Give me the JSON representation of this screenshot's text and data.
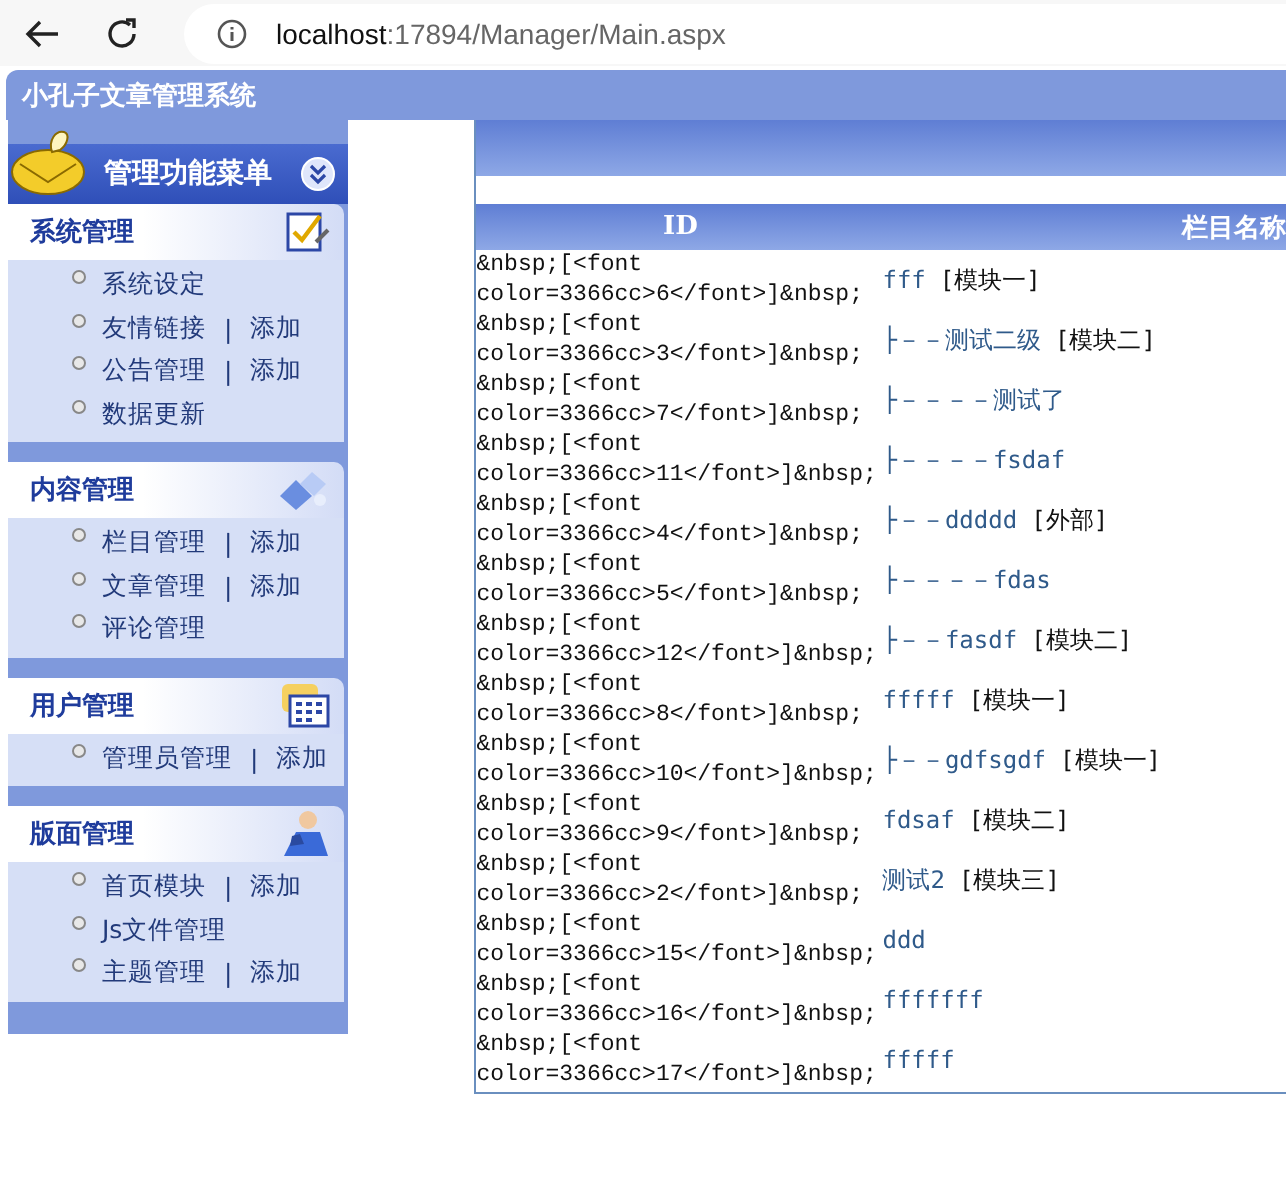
{
  "browser": {
    "url_host": "localhost",
    "url_path": ":17894/Manager/Main.aspx"
  },
  "title": "小孔子文章管理系统",
  "sidebar": {
    "heading": "管理功能菜单",
    "separator": "|",
    "sections": [
      {
        "title": "系统管理",
        "items": [
          {
            "links": [
              "系统设定"
            ]
          },
          {
            "links": [
              "友情链接",
              "添加"
            ]
          },
          {
            "links": [
              "公告管理",
              "添加"
            ]
          },
          {
            "links": [
              "数据更新"
            ]
          }
        ]
      },
      {
        "title": "内容管理",
        "items": [
          {
            "links": [
              "栏目管理",
              "添加"
            ]
          },
          {
            "links": [
              "文章管理",
              "添加"
            ]
          },
          {
            "links": [
              "评论管理"
            ]
          }
        ]
      },
      {
        "title": "用户管理",
        "items": [
          {
            "links": [
              "管理员管理",
              "添加"
            ]
          }
        ]
      },
      {
        "title": "版面管理",
        "items": [
          {
            "links": [
              "首页模块",
              "添加"
            ]
          },
          {
            "links": [
              "Js文件管理"
            ]
          },
          {
            "links": [
              "主题管理",
              "添加"
            ]
          }
        ]
      }
    ]
  },
  "table": {
    "columns": [
      "ID",
      "栏目名称"
    ],
    "rows": [
      {
        "id": "&nbsp;[<font color=3366cc>6</font>]&nbsp;",
        "name": "fff",
        "module": "[模块一]"
      },
      {
        "id": "&nbsp;[<font color=3366cc>3</font>]&nbsp;",
        "name": "├－－测试二级",
        "module": "[模块二]"
      },
      {
        "id": "&nbsp;[<font color=3366cc>7</font>]&nbsp;",
        "name": "├－－－－测试了"
      },
      {
        "id": "&nbsp;[<font color=3366cc>11</font>]&nbsp;",
        "name": "├－－－－fsdaf"
      },
      {
        "id": "&nbsp;[<font color=3366cc>4</font>]&nbsp;",
        "name": "├－－ddddd",
        "module": "[外部]"
      },
      {
        "id": "&nbsp;[<font color=3366cc>5</font>]&nbsp;",
        "name": "├－－－－fdas"
      },
      {
        "id": "&nbsp;[<font color=3366cc>12</font>]&nbsp;",
        "name": "├－－fasdf",
        "module": "[模块二]"
      },
      {
        "id": "&nbsp;[<font color=3366cc>8</font>]&nbsp;",
        "name": "fffff",
        "module": "[模块一]"
      },
      {
        "id": "&nbsp;[<font color=3366cc>10</font>]&nbsp;",
        "name": "├－－gdfsgdf",
        "module": "[模块一]"
      },
      {
        "id": "&nbsp;[<font color=3366cc>9</font>]&nbsp;",
        "name": "fdsaf",
        "module": "[模块二]"
      },
      {
        "id": "&nbsp;[<font color=3366cc>2</font>]&nbsp;",
        "name": "测试2",
        "module": "[模块三]"
      },
      {
        "id": "&nbsp;[<font color=3366cc>15</font>]&nbsp;",
        "name": "ddd"
      },
      {
        "id": "&nbsp;[<font color=3366cc>16</font>]&nbsp;",
        "name": "fffffff"
      },
      {
        "id": "&nbsp;[<font color=3366cc>17</font>]&nbsp;",
        "name": "fffff"
      }
    ]
  }
}
